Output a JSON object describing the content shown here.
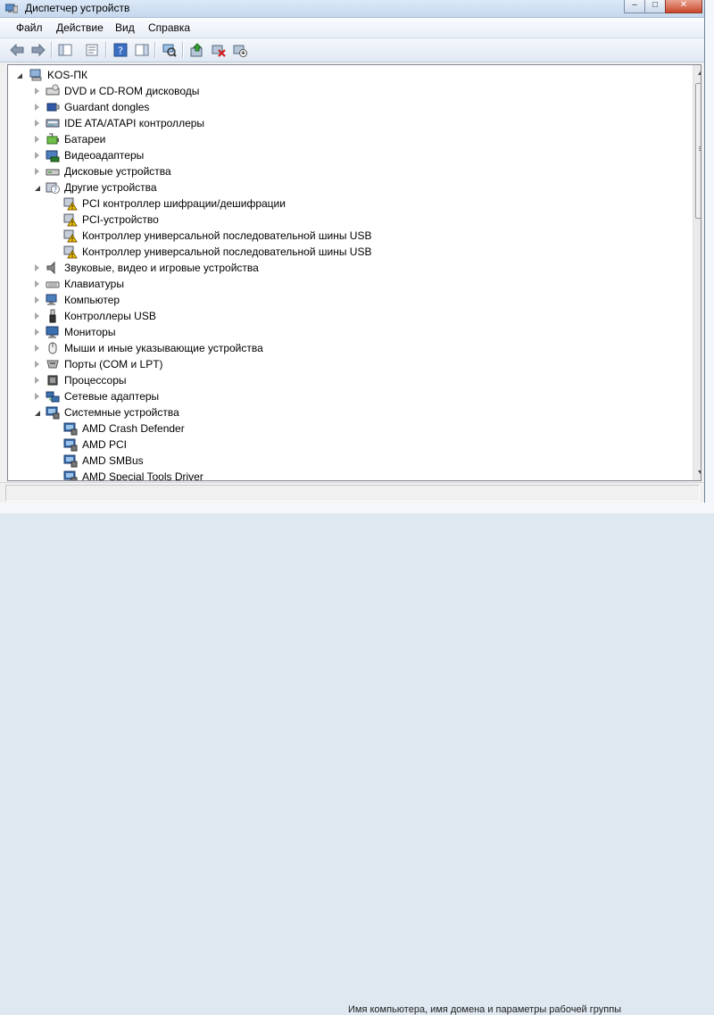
{
  "window": {
    "title": "Диспетчер устройств"
  },
  "menu": [
    "Файл",
    "Действие",
    "Вид",
    "Справка"
  ],
  "toolbar": {
    "buttons": [
      "back-icon",
      "forward-icon",
      "show-hide-console-tree-icon",
      "properties-icon",
      "help-icon",
      "show-action-pane-icon",
      "scan-hardware-icon",
      "update-driver-icon",
      "uninstall-icon",
      "disable-device-icon"
    ]
  },
  "tree": {
    "root": {
      "label": "KOS-ПК",
      "expanded": true
    },
    "rows": [
      {
        "label": "DVD и CD-ROM дисководы",
        "level": 1,
        "state": "collapsed",
        "icon": "dvd-drive-icon"
      },
      {
        "label": "Guardant dongles",
        "level": 1,
        "state": "collapsed",
        "icon": "dongle-icon"
      },
      {
        "label": "IDE ATA/ATAPI контроллеры",
        "level": 1,
        "state": "collapsed",
        "icon": "ide-controller-icon"
      },
      {
        "label": "Батареи",
        "level": 1,
        "state": "collapsed",
        "icon": "battery-icon"
      },
      {
        "label": "Видеоадаптеры",
        "level": 1,
        "state": "collapsed",
        "icon": "display-adapter-icon"
      },
      {
        "label": "Дисковые устройства",
        "level": 1,
        "state": "collapsed",
        "icon": "disk-drive-icon"
      },
      {
        "label": "Другие устройства",
        "level": 1,
        "state": "expanded",
        "icon": "unknown-device-icon"
      },
      {
        "label": "PCI контроллер шифрации/дешифрации",
        "level": 2,
        "state": "leaf",
        "icon": "warning-device-icon"
      },
      {
        "label": "PCI-устройство",
        "level": 2,
        "state": "leaf",
        "icon": "warning-device-icon"
      },
      {
        "label": "Контроллер универсальной последовательной шины USB",
        "level": 2,
        "state": "leaf",
        "icon": "warning-device-icon"
      },
      {
        "label": "Контроллер универсальной последовательной шины USB",
        "level": 2,
        "state": "leaf",
        "icon": "warning-device-icon"
      },
      {
        "label": "Звуковые, видео и игровые устройства",
        "level": 1,
        "state": "collapsed",
        "icon": "speaker-icon"
      },
      {
        "label": "Клавиатуры",
        "level": 1,
        "state": "collapsed",
        "icon": "keyboard-icon"
      },
      {
        "label": "Компьютер",
        "level": 1,
        "state": "collapsed",
        "icon": "computer-icon"
      },
      {
        "label": "Контроллеры USB",
        "level": 1,
        "state": "collapsed",
        "icon": "usb-icon"
      },
      {
        "label": "Мониторы",
        "level": 1,
        "state": "collapsed",
        "icon": "monitor-icon"
      },
      {
        "label": "Мыши и иные указывающие устройства",
        "level": 1,
        "state": "collapsed",
        "icon": "mouse-icon"
      },
      {
        "label": "Порты (COM и LPT)",
        "level": 1,
        "state": "collapsed",
        "icon": "port-icon"
      },
      {
        "label": "Процессоры",
        "level": 1,
        "state": "collapsed",
        "icon": "processor-icon"
      },
      {
        "label": "Сетевые адаптеры",
        "level": 1,
        "state": "collapsed",
        "icon": "network-adapter-icon"
      },
      {
        "label": "Системные устройства",
        "level": 1,
        "state": "expanded",
        "icon": "system-device-icon"
      },
      {
        "label": "AMD Crash Defender",
        "level": 2,
        "state": "leaf",
        "icon": "system-device-icon"
      },
      {
        "label": "AMD PCI",
        "level": 2,
        "state": "leaf",
        "icon": "system-device-icon"
      },
      {
        "label": "AMD SMBus",
        "level": 2,
        "state": "leaf",
        "icon": "system-device-icon"
      },
      {
        "label": "AMD Special Tools Driver",
        "level": 2,
        "state": "leaf",
        "icon": "system-device-icon"
      }
    ]
  },
  "background": {
    "bottom_text": "Имя компьютера, имя домена и параметры рабочей группы"
  },
  "colors": {
    "titlebar": "#c6d8ee",
    "pane_bg": "#ffffff",
    "warning": "#f5c400"
  }
}
